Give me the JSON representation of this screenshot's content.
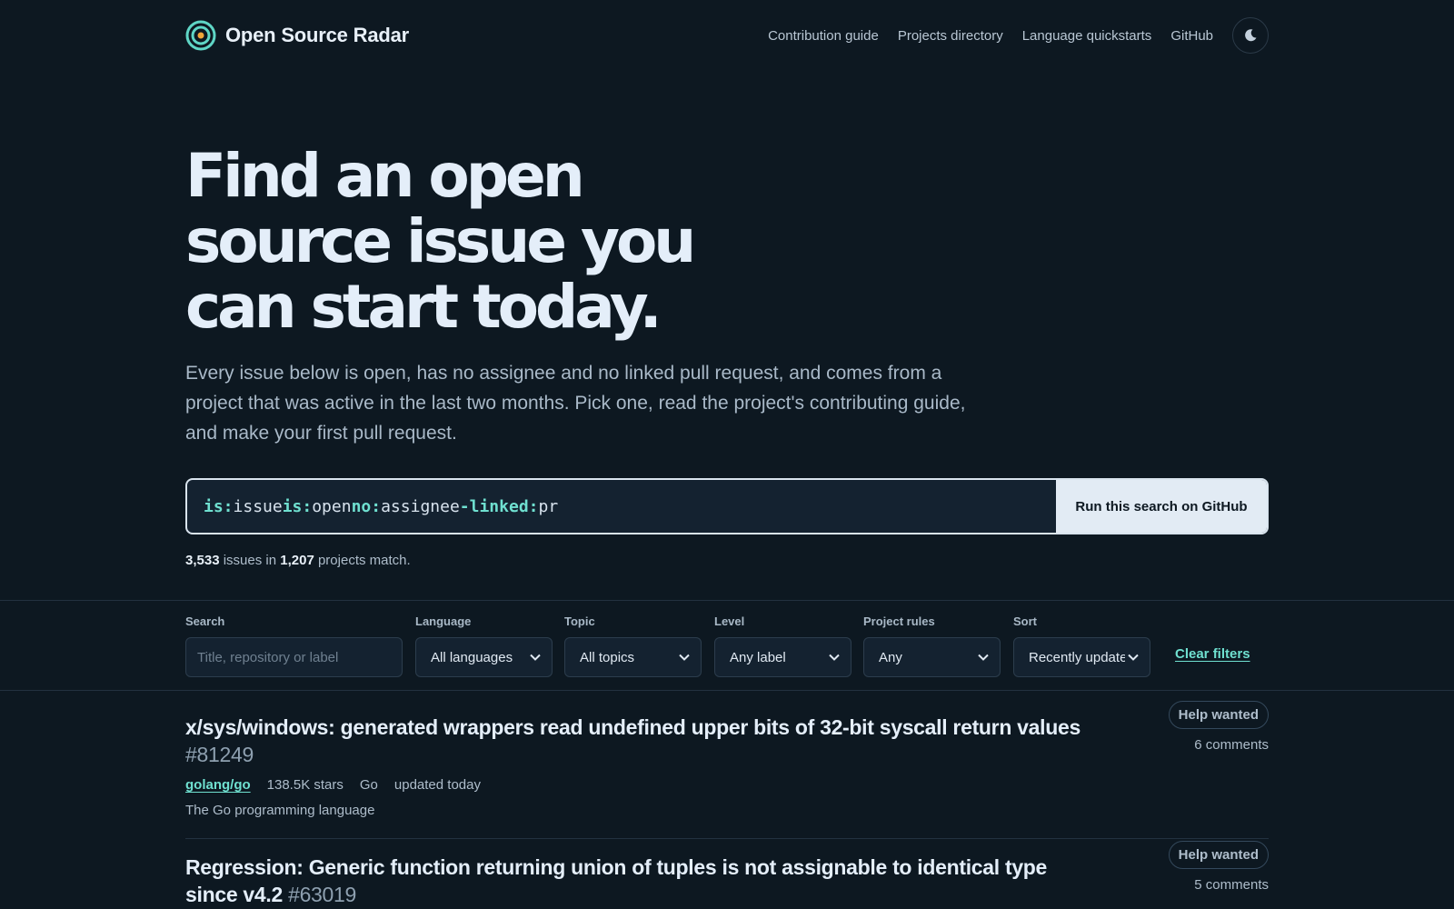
{
  "header": {
    "brand": "Open Source Radar",
    "nav": [
      "Contribution guide",
      "Projects directory",
      "Language quickstarts",
      "GitHub"
    ],
    "theme_icon": "moon-icon"
  },
  "hero": {
    "title": "Find an open source issue you can start today.",
    "description": "Every issue below is open, has no assignee and no linked pull request, and comes from a project that was active in the last two months. Pick one, read the project's contributing guide, and make your first pull request."
  },
  "query": {
    "tokens": [
      {
        "key": "is:",
        "val": "issue"
      },
      {
        "key": "is:",
        "val": "open"
      },
      {
        "key": "no:",
        "val": "assignee"
      },
      {
        "key": "-linked:",
        "val": "pr"
      }
    ],
    "button": "Run this search on GitHub"
  },
  "summary": {
    "issues_count": "3,533",
    "issues_word": "issues in",
    "projects_count": "1,207",
    "projects_word": "projects match."
  },
  "filters": {
    "search": {
      "label": "Search",
      "placeholder": "Title, repository or label"
    },
    "language": {
      "label": "Language",
      "value": "All languages"
    },
    "topic": {
      "label": "Topic",
      "value": "All topics"
    },
    "level": {
      "label": "Level",
      "value": "Any label"
    },
    "project_rules": {
      "label": "Project rules",
      "value": "Any"
    },
    "sort": {
      "label": "Sort",
      "value": "Recently updated"
    },
    "clear": "Clear filters"
  },
  "issues": [
    {
      "title": "x/sys/windows: generated wrappers read undefined upper bits of 32-bit syscall return values",
      "number": "#81249",
      "repo": "golang/go",
      "stars": "138.5K stars",
      "language": "Go",
      "updated": "updated today",
      "description": "The Go programming language",
      "badge": "Help wanted",
      "comments": "6 comments"
    },
    {
      "title": "Regression: Generic function returning union of tuples is not assignable to identical type since v4.2",
      "number": "#63019",
      "badge": "Help wanted",
      "comments": "5 comments"
    }
  ],
  "colors": {
    "background": "#0d1821",
    "accent": "#6fe0d0",
    "text": "#e4eef9"
  }
}
